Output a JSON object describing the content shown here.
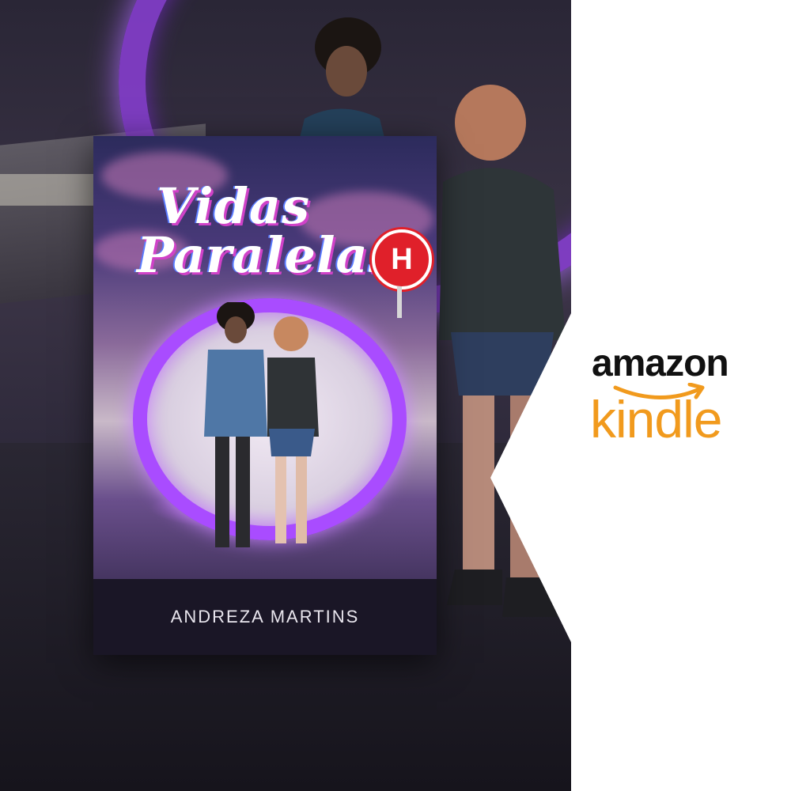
{
  "cover": {
    "title_line_1": "Vidas",
    "title_line_2": "Paralelas",
    "sign_letter": "H",
    "author": "ANDREZA MARTINS"
  },
  "logo": {
    "brand": "amazon",
    "product": "kindle",
    "brand_color": "#111111",
    "accent_color": "#f19a1d",
    "icon": "amazon-smile-arrow-icon"
  },
  "colors": {
    "portal": "#a94cff",
    "sign": "#e0202a",
    "background": "#ffffff"
  }
}
